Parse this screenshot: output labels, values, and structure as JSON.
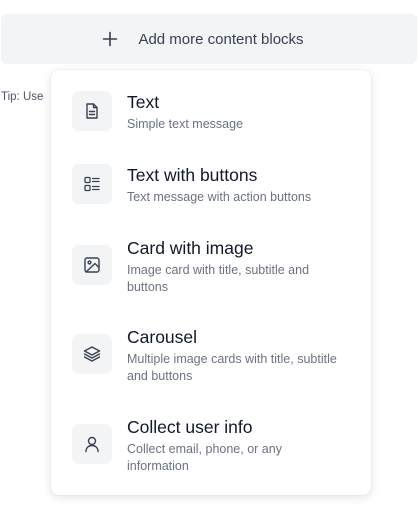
{
  "add_bar": {
    "label": "Add more content blocks",
    "icon": "plus-icon"
  },
  "tip": {
    "text": "Tip: Use"
  },
  "menu": {
    "items": [
      {
        "title": "Text",
        "description": "Simple text message",
        "icon": "document-icon"
      },
      {
        "title": "Text with buttons",
        "description": "Text message with action buttons",
        "icon": "list-buttons-icon"
      },
      {
        "title": "Card with image",
        "description": "Image card with title, subtitle and buttons",
        "icon": "image-icon"
      },
      {
        "title": "Carousel",
        "description": "Multiple image cards with title, subtitle and buttons",
        "icon": "layers-icon"
      },
      {
        "title": "Collect user info",
        "description": "Collect email, phone, or any information",
        "icon": "user-icon"
      }
    ]
  },
  "colors": {
    "bar_background": "#f3f4f6",
    "icon_box_background": "#f3f4f6",
    "title_text": "#111827",
    "description_text": "#6b7280"
  }
}
